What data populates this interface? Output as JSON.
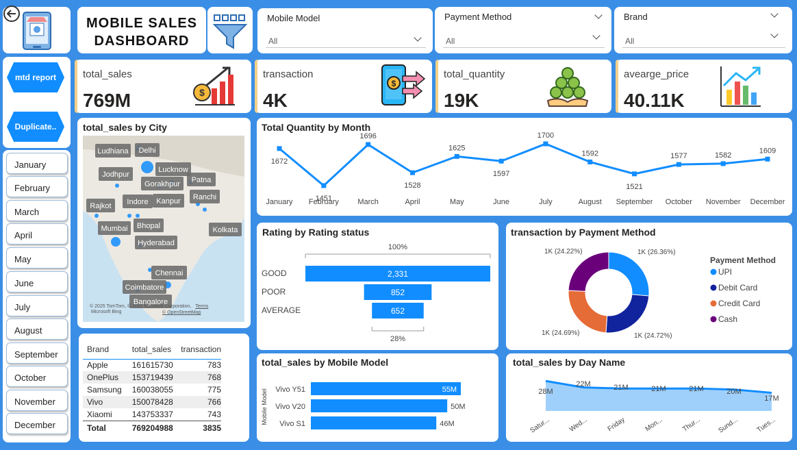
{
  "colors": {
    "background": "#3a8ee6",
    "accent": "#118dff",
    "dark_blue": "#12239e",
    "orange": "#e66c37",
    "purple": "#6b007b"
  },
  "nav": {
    "back_icon": "back-arrow-icon",
    "logo_icon": "mobile-store-icon",
    "filter_icon": "funnel-filter-icon"
  },
  "header": {
    "title_line1": "MOBILE SALES",
    "title_line2": "DASHBOARD"
  },
  "slicers": [
    {
      "label": "Mobile Model",
      "value": "All"
    },
    {
      "label": "Payment Method",
      "value": "All"
    },
    {
      "label": "Brand",
      "value": "All"
    }
  ],
  "buttons": {
    "mtd": "mtd report",
    "duplicate": "Duplicate.."
  },
  "months": [
    "January",
    "February",
    "March",
    "April",
    "May",
    "June",
    "July",
    "August",
    "September",
    "October",
    "November",
    "December"
  ],
  "kpis": [
    {
      "label": "total_sales",
      "value": "769M",
      "icon": "money-growth-chart-icon"
    },
    {
      "label": "transaction",
      "value": "4K",
      "icon": "phone-payment-icon"
    },
    {
      "label": "total_quantity",
      "value": "19K",
      "icon": "coin-stack-hand-icon"
    },
    {
      "label": "avearge_price",
      "value": "40.11K",
      "icon": "bar-chart-trend-icon"
    }
  ],
  "map": {
    "title": "total_sales by City",
    "cities": [
      "Ludhiana",
      "Delhi",
      "Lucknow",
      "Jodhpur",
      "Gorakhpur",
      "Patna",
      "Ranchi",
      "Kanpur",
      "Indore",
      "Rajkot",
      "Bhopal",
      "Mumbai",
      "Kolkata",
      "Hyderabad",
      "Chennai",
      "Coimbatore",
      "Bangalore"
    ],
    "attribution": "© 2025 TomTom, © 2025 Microsoft Corporation,",
    "terms": "Terms",
    "bing": "Microsoft Bing",
    "osm": "© OpenStreetMap"
  },
  "line_chart": {
    "title": "Total Quantity by Month",
    "chart_data": {
      "type": "line",
      "categories": [
        "January",
        "February",
        "March",
        "April",
        "May",
        "June",
        "July",
        "August",
        "September",
        "October",
        "November",
        "December"
      ],
      "values": [
        1672,
        1451,
        1696,
        1528,
        1625,
        1597,
        1700,
        1592,
        1521,
        1577,
        1582,
        1609
      ]
    }
  },
  "funnel": {
    "title": "Rating by Rating status",
    "top_pct": "100%",
    "bottom_pct": "28%",
    "chart_data": {
      "type": "bar",
      "categories": [
        "GOOD",
        "POOR",
        "AVERAGE"
      ],
      "values": [
        2331,
        852,
        652
      ],
      "labels": [
        "2,331",
        "852",
        "652"
      ]
    }
  },
  "donut": {
    "title": "transaction by Payment Method",
    "legend_title": "Payment Method",
    "chart_data": {
      "type": "pie",
      "categories": [
        "UPI",
        "Debit Card",
        "Credit Card",
        "Cash"
      ],
      "values": [
        26.36,
        24.72,
        24.69,
        24.22
      ],
      "labels": [
        "1K (26.36%)",
        "1K (24.72%)",
        "1K (24.69%)",
        "1K (24.22%)"
      ],
      "colors": [
        "#118dff",
        "#12239e",
        "#e66c37",
        "#6b007b"
      ]
    }
  },
  "brand_table": {
    "headers": [
      "Brand",
      "total_sales",
      "transaction"
    ],
    "rows": [
      [
        "Apple",
        "161615730",
        "783"
      ],
      [
        "OnePlus",
        "153719439",
        "768"
      ],
      [
        "Samsung",
        "160038055",
        "775"
      ],
      [
        "Vivo",
        "150078428",
        "766"
      ],
      [
        "Xiaomi",
        "143753337",
        "743"
      ]
    ],
    "total": [
      "Total",
      "769204988",
      "3835"
    ]
  },
  "model_chart": {
    "title": "total_sales by Mobile Model",
    "ylabel": "Mobile Model",
    "chart_data": {
      "type": "bar",
      "categories": [
        "Vivo Y51",
        "Vivo V20",
        "Vivo S1"
      ],
      "values": [
        55,
        50,
        46
      ],
      "labels": [
        "55M",
        "50M",
        "46M"
      ]
    }
  },
  "day_chart": {
    "title": "total_sales by Day Name",
    "chart_data": {
      "type": "area",
      "categories": [
        "Satur...",
        "Wed...",
        "Friday",
        "Mon...",
        "Thur...",
        "Sund...",
        "Tues..."
      ],
      "values": [
        28,
        22,
        21,
        21,
        21,
        20,
        17
      ],
      "labels": [
        "28M",
        "22M",
        "21M",
        "21M",
        "21M",
        "20M",
        "17M"
      ]
    }
  }
}
